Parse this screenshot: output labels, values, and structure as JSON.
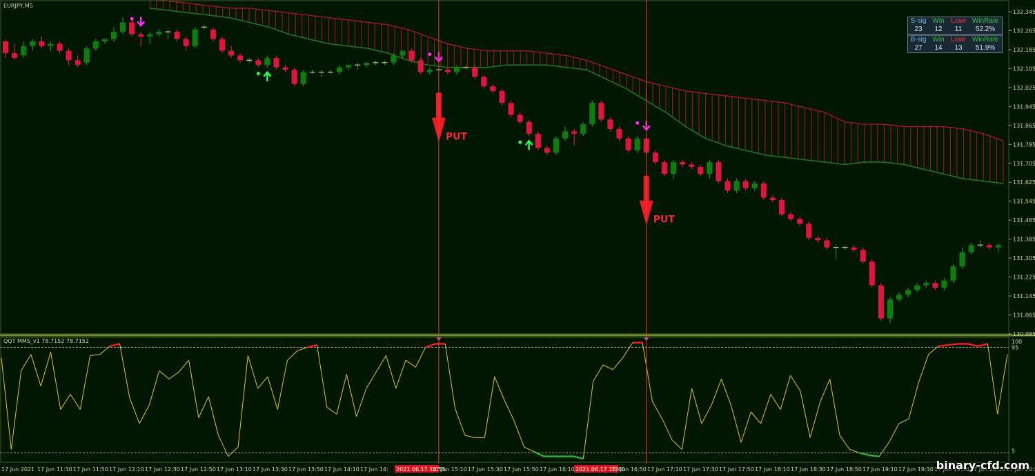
{
  "window": {
    "symbol_label": "EURJPY,M5",
    "indicator_label": "QQT MMS_v1 78.7152 78.7152"
  },
  "watermark": "binary-cfd.com",
  "stats": {
    "s_row": {
      "label": "S-sig",
      "win_label": "Win",
      "lose_label": "Lose",
      "rate_label": "WinRate",
      "total": "23",
      "win": "12",
      "lose": "11",
      "rate": "52.2%"
    },
    "b_row": {
      "label": "B-sig",
      "win_label": "Win",
      "lose_label": "Lose",
      "rate_label": "WinRate",
      "total": "27",
      "win": "14",
      "lose": "13",
      "rate": "51.9%"
    }
  },
  "signals": {
    "put_label": "PUT"
  },
  "colors": {
    "bull": "#0c7e0c",
    "bear": "#e0143c",
    "cloud_line": "#1f7a1f",
    "cloud_hatch": "#c0152b",
    "osc_line": "#e5c61c",
    "osc_hot": "#ff1a1a",
    "osc_cold": "#2bb82b",
    "vline": "#e83b2b",
    "bg": "#021702",
    "axis_text": "#cfd8a8"
  },
  "chart_data": [
    {
      "type": "candlestick",
      "title": "EURJPY,M5",
      "ylim": [
        130.985,
        132.345
      ],
      "y_ticks": [
        "132.345",
        "132.265",
        "132.185",
        "132.105",
        "132.025",
        "131.945",
        "131.865",
        "131.785",
        "131.705",
        "131.625",
        "131.545",
        "131.465",
        "131.385",
        "131.305",
        "131.225",
        "131.145",
        "131.065",
        "130.985"
      ],
      "candles": [
        [
          132.22,
          132.23,
          132.15,
          132.17
        ],
        [
          132.17,
          132.21,
          132.14,
          132.15
        ],
        [
          132.16,
          132.22,
          132.15,
          132.2
        ],
        [
          132.2,
          132.23,
          132.18,
          132.22
        ],
        [
          132.22,
          132.24,
          132.19,
          132.2
        ],
        [
          132.2,
          132.22,
          132.18,
          132.21
        ],
        [
          132.21,
          132.22,
          132.17,
          132.18
        ],
        [
          132.18,
          132.19,
          132.12,
          132.14
        ],
        [
          132.14,
          132.16,
          132.11,
          132.12
        ],
        [
          132.13,
          132.2,
          132.12,
          132.19
        ],
        [
          132.19,
          132.23,
          132.18,
          132.22
        ],
        [
          132.22,
          132.23,
          132.21,
          132.23
        ],
        [
          132.23,
          132.28,
          132.22,
          132.26
        ],
        [
          132.26,
          132.32,
          132.25,
          132.3
        ],
        [
          132.3,
          132.31,
          132.24,
          132.25
        ],
        [
          132.25,
          132.26,
          132.2,
          132.24
        ],
        [
          132.24,
          132.26,
          132.21,
          132.25
        ],
        [
          132.25,
          132.27,
          132.24,
          132.26
        ],
        [
          132.26,
          132.27,
          132.23,
          132.26
        ],
        [
          132.26,
          132.27,
          132.22,
          132.23
        ],
        [
          132.23,
          132.24,
          132.18,
          132.2
        ],
        [
          132.2,
          132.28,
          132.19,
          132.27
        ],
        [
          132.28,
          132.29,
          132.27,
          132.28
        ],
        [
          132.27,
          132.28,
          132.22,
          132.23
        ],
        [
          132.23,
          132.24,
          132.17,
          132.18
        ],
        [
          132.18,
          132.2,
          132.15,
          132.16
        ],
        [
          132.16,
          132.17,
          132.13,
          132.14
        ],
        [
          132.14,
          132.15,
          132.13,
          132.14
        ],
        [
          132.14,
          132.15,
          132.11,
          132.12
        ],
        [
          132.12,
          132.16,
          132.11,
          132.15
        ],
        [
          132.15,
          132.16,
          132.1,
          132.11
        ],
        [
          132.11,
          132.12,
          132.09,
          132.1
        ],
        [
          132.1,
          132.11,
          132.03,
          132.04
        ],
        [
          132.04,
          132.1,
          132.03,
          132.09
        ],
        [
          132.09,
          132.1,
          132.08,
          132.09
        ],
        [
          132.09,
          132.1,
          132.07,
          132.09
        ],
        [
          132.09,
          132.1,
          132.08,
          132.09
        ],
        [
          132.09,
          132.12,
          132.08,
          132.11
        ],
        [
          132.11,
          132.12,
          132.1,
          132.12
        ],
        [
          132.12,
          132.13,
          132.1,
          132.12
        ],
        [
          132.12,
          132.13,
          132.11,
          132.13
        ],
        [
          132.13,
          132.14,
          132.12,
          132.13
        ],
        [
          132.13,
          132.14,
          132.12,
          132.13
        ],
        [
          132.13,
          132.17,
          132.12,
          132.16
        ],
        [
          132.16,
          132.18,
          132.15,
          132.18
        ],
        [
          132.18,
          132.19,
          132.13,
          132.14
        ],
        [
          132.14,
          132.15,
          132.08,
          132.09
        ],
        [
          132.09,
          132.11,
          132.08,
          132.1
        ],
        [
          132.1,
          132.11,
          132.09,
          132.1
        ],
        [
          132.1,
          132.11,
          132.08,
          132.09
        ],
        [
          132.09,
          132.12,
          132.08,
          132.11
        ],
        [
          132.11,
          132.12,
          132.1,
          132.11
        ],
        [
          132.11,
          132.12,
          132.06,
          132.07
        ],
        [
          132.07,
          132.08,
          132.02,
          132.03
        ],
        [
          132.03,
          132.04,
          132.0,
          132.01
        ],
        [
          132.01,
          132.02,
          131.95,
          131.96
        ],
        [
          131.96,
          131.97,
          131.9,
          131.91
        ],
        [
          131.91,
          131.92,
          131.87,
          131.88
        ],
        [
          131.88,
          131.89,
          131.82,
          131.83
        ],
        [
          131.83,
          131.84,
          131.76,
          131.77
        ],
        [
          131.77,
          131.78,
          131.74,
          131.75
        ],
        [
          131.75,
          131.82,
          131.74,
          131.81
        ],
        [
          131.81,
          131.86,
          131.8,
          131.84
        ],
        [
          131.84,
          131.85,
          131.78,
          131.83
        ],
        [
          131.83,
          131.88,
          131.82,
          131.87
        ],
        [
          131.87,
          131.97,
          131.86,
          131.96
        ],
        [
          131.96,
          131.97,
          131.88,
          131.89
        ],
        [
          131.89,
          131.9,
          131.84,
          131.85
        ],
        [
          131.85,
          131.86,
          131.8,
          131.81
        ],
        [
          131.81,
          131.82,
          131.75,
          131.76
        ],
        [
          131.76,
          131.82,
          131.75,
          131.81
        ],
        [
          131.81,
          131.82,
          131.74,
          131.75
        ],
        [
          131.75,
          131.76,
          131.7,
          131.71
        ],
        [
          131.71,
          131.72,
          131.65,
          131.66
        ],
        [
          131.66,
          131.72,
          131.64,
          131.71
        ],
        [
          131.71,
          131.72,
          131.69,
          131.7
        ],
        [
          131.7,
          131.71,
          131.68,
          131.69
        ],
        [
          131.69,
          131.7,
          131.65,
          131.66
        ],
        [
          131.66,
          131.72,
          131.64,
          131.71
        ],
        [
          131.71,
          131.72,
          131.62,
          131.63
        ],
        [
          131.63,
          131.64,
          131.58,
          131.59
        ],
        [
          131.59,
          131.64,
          131.58,
          131.63
        ],
        [
          131.63,
          131.64,
          131.59,
          131.6
        ],
        [
          131.6,
          131.63,
          131.59,
          131.62
        ],
        [
          131.62,
          131.63,
          131.55,
          131.56
        ],
        [
          131.56,
          131.57,
          131.54,
          131.55
        ],
        [
          131.55,
          131.56,
          131.48,
          131.49
        ],
        [
          131.49,
          131.5,
          131.46,
          131.47
        ],
        [
          131.47,
          131.48,
          131.44,
          131.45
        ],
        [
          131.45,
          131.46,
          131.38,
          131.39
        ],
        [
          131.39,
          131.4,
          131.37,
          131.38
        ],
        [
          131.38,
          131.39,
          131.34,
          131.35
        ],
        [
          131.35,
          131.36,
          131.3,
          131.35
        ],
        [
          131.35,
          131.36,
          131.34,
          131.35
        ],
        [
          131.35,
          131.36,
          131.33,
          131.34
        ],
        [
          131.34,
          131.35,
          131.28,
          131.29
        ],
        [
          131.29,
          131.3,
          131.18,
          131.19
        ],
        [
          131.19,
          131.2,
          131.04,
          131.05
        ],
        [
          131.05,
          131.14,
          131.03,
          131.13
        ],
        [
          131.13,
          131.16,
          131.12,
          131.15
        ],
        [
          131.15,
          131.18,
          131.14,
          131.17
        ],
        [
          131.17,
          131.2,
          131.16,
          131.19
        ],
        [
          131.19,
          131.21,
          131.18,
          131.2
        ],
        [
          131.2,
          131.21,
          131.17,
          131.18
        ],
        [
          131.18,
          131.22,
          131.17,
          131.21
        ],
        [
          131.21,
          131.28,
          131.2,
          131.27
        ],
        [
          131.27,
          131.35,
          131.26,
          131.33
        ],
        [
          131.33,
          131.37,
          131.32,
          131.36
        ],
        [
          131.36,
          131.38,
          131.35,
          131.36
        ],
        [
          131.36,
          131.37,
          131.34,
          131.35
        ],
        [
          131.35,
          131.37,
          131.33,
          131.36
        ]
      ],
      "cloud_top": [
        132.4,
        132.39,
        132.38,
        132.37,
        132.36,
        132.36,
        132.35,
        132.34,
        132.33,
        132.32,
        132.31,
        132.3,
        132.29,
        132.27,
        132.24,
        132.21,
        132.19,
        132.18,
        132.18,
        132.18,
        132.17,
        132.16,
        132.14,
        132.11,
        132.08,
        132.05,
        132.03,
        132.01,
        132.0,
        131.99,
        131.98,
        131.97,
        131.96,
        131.94,
        131.92,
        131.88,
        131.87,
        131.87,
        131.86,
        131.86,
        131.86,
        131.85,
        131.83,
        131.8
      ],
      "cloud_bottom": [
        132.36,
        132.35,
        132.34,
        132.33,
        132.32,
        132.3,
        132.28,
        132.25,
        132.23,
        132.21,
        132.2,
        132.19,
        132.17,
        132.14,
        132.12,
        132.11,
        132.11,
        132.11,
        132.12,
        132.12,
        132.12,
        132.11,
        132.1,
        132.06,
        132.02,
        131.97,
        131.92,
        131.86,
        131.81,
        131.78,
        131.76,
        131.74,
        131.73,
        131.72,
        131.71,
        131.7,
        131.71,
        131.71,
        131.7,
        131.68,
        131.66,
        131.64,
        131.63,
        131.62
      ],
      "put_signals": [
        48,
        71
      ],
      "buy_arrows": [
        29,
        58
      ],
      "sell_arrows": [
        15,
        48,
        71
      ]
    },
    {
      "type": "line",
      "title": "QQT MMS_v1 78.7152 78.7152",
      "ylim": [
        0,
        100
      ],
      "levels": [
        5,
        95
      ],
      "y_ticks": [
        "100",
        "95",
        "5"
      ],
      "values": [
        86,
        8,
        75,
        89,
        62,
        91,
        42,
        55,
        42,
        88,
        89,
        96,
        98,
        52,
        30,
        46,
        75,
        68,
        74,
        84,
        35,
        53,
        20,
        2,
        10,
        88,
        60,
        70,
        42,
        84,
        92,
        95,
        97,
        44,
        38,
        72,
        36,
        60,
        74,
        88,
        60,
        84,
        78,
        95,
        98,
        98,
        43,
        20,
        18,
        18,
        70,
        50,
        32,
        10,
        6,
        2,
        2,
        2,
        2,
        0,
        66,
        80,
        76,
        86,
        99,
        99,
        49,
        34,
        16,
        8,
        60,
        30,
        46,
        68,
        45,
        14,
        40,
        30,
        55,
        42,
        71,
        58,
        18,
        48,
        68,
        20,
        8,
        5,
        3,
        2,
        14,
        30,
        34,
        65,
        89,
        96,
        97,
        98,
        98,
        96,
        98,
        38,
        89
      ]
    }
  ],
  "x_axis_labels": [
    "17 Jun 2021",
    "17 Jun 11:30",
    "17 Jun 11:50",
    "17 Jun 12:10",
    "17 Jun 12:30",
    "17 Jun 12:50",
    "17 Jun 13:10",
    "17 Jun 13:30",
    "17 Jun 13:50",
    "17 Jun 14:10",
    "17 Jun 14:",
    "2021.06.17 14:55",
    "17 Jun 15:10",
    "17 Jun 15:30",
    "17 Jun 15:50",
    "17 Jun 16:10",
    "2021.06.17 16:40",
    "17 Jun 16:50",
    "17 Jun 17:10",
    "17 Jun 17:30",
    "17 Jun 17:50",
    "17 Jun 18:10",
    "17 Jun 18:30",
    "17 Jun 18:50",
    "17 Jun 19:10",
    "17 Jun 19:30",
    "17 Jun 19:50",
    "17 Jun 20:10",
    "17 Jun 20:3"
  ]
}
